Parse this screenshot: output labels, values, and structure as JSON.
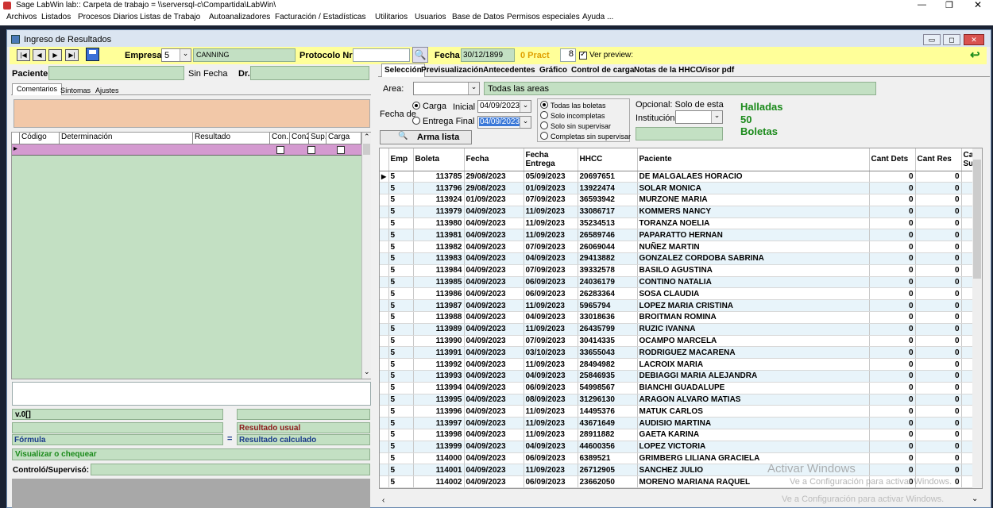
{
  "outer": {
    "title": "Sage LabWin lab:: Carpeta de trabajo = \\\\serversql-c\\Compartida\\LabWin\\"
  },
  "menu": [
    "Archivos",
    "Listados",
    "Procesos Diarios",
    "Listas de Trabajo",
    "Autoanalizadores",
    "Facturación / Estadísticas",
    "Utilitarios",
    "Usuarios",
    "Base de Datos",
    "Permisos especiales",
    "Ayuda ..."
  ],
  "win": {
    "title": "Ingreso de Resultados"
  },
  "toolbar": {
    "empresa_label": "Empresa:",
    "empresa_value": "5",
    "empresa_name": "CANNING",
    "protocolo_label": "Protocolo Nro.:",
    "protocolo_value": "",
    "fecha_label": "Fecha",
    "fecha_value": "30/12/1899",
    "pract": "0 Pract",
    "copies": "8",
    "ver_preview": "Ver preview:"
  },
  "left": {
    "paciente_label": "Paciente:",
    "sin_fecha": "Sin Fecha",
    "dr_label": "Dr.",
    "tabs": [
      "Comentarios",
      "Síntomas",
      "Ajustes"
    ],
    "grid_headers": [
      "Código",
      "Determinación",
      "Resultado",
      "Con.",
      "Con2",
      "Sup.",
      "Carga"
    ],
    "version": "v.0[]",
    "resultado_usual": "Resultado usual",
    "formula": "Fórmula",
    "eq": "=",
    "resultado_calculado": "Resultado calculado",
    "visualizar": "Visualizar o chequear",
    "controlo": "Controló/Supervisó:"
  },
  "right": {
    "tabs": [
      "Selección",
      "Previsualización",
      "Antecedentes",
      "Gráfico",
      "Control de carga",
      "Notas de la HHCC",
      "Visor pdf"
    ],
    "area_label": "Area:",
    "area_value": "Todas las areas",
    "fecha_de": "Fecha de",
    "carga": "Carga",
    "entrega_final": "Entrega Final",
    "inicial": "Inicial",
    "date1": "04/09/2023",
    "date2": "04/09/2023",
    "filters": [
      "Todas las boletas",
      "Solo incompletas",
      "Solo sin supervisar",
      "Completas sin supervisar"
    ],
    "opcional": "Opcional: Solo de esta",
    "institucion": "Institución",
    "halladas": "Halladas",
    "count": "50",
    "boletas": "Boletas",
    "arma_lista": "Arma lista",
    "headers": [
      "Emp",
      "Boleta",
      "Fecha",
      "Fecha Entrega",
      "HHCC",
      "Paciente",
      "Cant Dets",
      "Cant Res",
      "Ca Su"
    ],
    "rows": [
      [
        "5",
        "113785",
        "29/08/2023",
        "05/09/2023",
        "20697651",
        "DE MALGALAES HORACIO",
        "0",
        "0"
      ],
      [
        "5",
        "113796",
        "29/08/2023",
        "01/09/2023",
        "13922474",
        "SOLAR MONICA",
        "0",
        "0"
      ],
      [
        "5",
        "113924",
        "01/09/2023",
        "07/09/2023",
        "36593942",
        "MURZONE MARIA",
        "0",
        "0"
      ],
      [
        "5",
        "113979",
        "04/09/2023",
        "11/09/2023",
        "33086717",
        "KOMMERS NANCY",
        "0",
        "0"
      ],
      [
        "5",
        "113980",
        "04/09/2023",
        "11/09/2023",
        "35234513",
        "TORANZA NOELIA",
        "0",
        "0"
      ],
      [
        "5",
        "113981",
        "04/09/2023",
        "11/09/2023",
        "26589746",
        "PAPARATTO HERNAN",
        "0",
        "0"
      ],
      [
        "5",
        "113982",
        "04/09/2023",
        "07/09/2023",
        "26069044",
        "NUÑEZ MARTIN",
        "0",
        "0"
      ],
      [
        "5",
        "113983",
        "04/09/2023",
        "04/09/2023",
        "29413882",
        "GONZALEZ CORDOBA SABRINA",
        "0",
        "0"
      ],
      [
        "5",
        "113984",
        "04/09/2023",
        "07/09/2023",
        "39332578",
        "BASILO AGUSTINA",
        "0",
        "0"
      ],
      [
        "5",
        "113985",
        "04/09/2023",
        "06/09/2023",
        "24036179",
        "CONTINO NATALIA",
        "0",
        "0"
      ],
      [
        "5",
        "113986",
        "04/09/2023",
        "06/09/2023",
        "26283364",
        "SOSA CLAUDIA",
        "0",
        "0"
      ],
      [
        "5",
        "113987",
        "04/09/2023",
        "11/09/2023",
        "5965794",
        "LOPEZ MARIA CRISTINA",
        "0",
        "0"
      ],
      [
        "5",
        "113988",
        "04/09/2023",
        "04/09/2023",
        "33018636",
        "BROITMAN ROMINA",
        "0",
        "0"
      ],
      [
        "5",
        "113989",
        "04/09/2023",
        "11/09/2023",
        "26435799",
        "RUZIC IVANNA",
        "0",
        "0"
      ],
      [
        "5",
        "113990",
        "04/09/2023",
        "07/09/2023",
        "30414335",
        "OCAMPO MARCELA",
        "0",
        "0"
      ],
      [
        "5",
        "113991",
        "04/09/2023",
        "03/10/2023",
        "33655043",
        "RODRIGUEZ MACARENA",
        "0",
        "0"
      ],
      [
        "5",
        "113992",
        "04/09/2023",
        "11/09/2023",
        "28494982",
        "LACROIX MARIA",
        "0",
        "0"
      ],
      [
        "5",
        "113993",
        "04/09/2023",
        "04/09/2023",
        "25846935",
        "DEBIAGGI MARIA ALEJANDRA",
        "0",
        "0"
      ],
      [
        "5",
        "113994",
        "04/09/2023",
        "06/09/2023",
        "54998567",
        "BIANCHI GUADALUPE",
        "0",
        "0"
      ],
      [
        "5",
        "113995",
        "04/09/2023",
        "08/09/2023",
        "31296130",
        "ARAGON ALVARO MATIAS",
        "0",
        "0"
      ],
      [
        "5",
        "113996",
        "04/09/2023",
        "11/09/2023",
        "14495376",
        "MATUK CARLOS",
        "0",
        "0"
      ],
      [
        "5",
        "113997",
        "04/09/2023",
        "11/09/2023",
        "43671649",
        "AUDISIO MARTINA",
        "0",
        "0"
      ],
      [
        "5",
        "113998",
        "04/09/2023",
        "11/09/2023",
        "28911882",
        "GAETA KARINA",
        "0",
        "0"
      ],
      [
        "5",
        "113999",
        "04/09/2023",
        "04/09/2023",
        "44600356",
        "LOPEZ VICTORIA",
        "0",
        "0"
      ],
      [
        "5",
        "114000",
        "04/09/2023",
        "06/09/2023",
        "6389521",
        "GRIMBERG LILIANA GRACIELA",
        "0",
        "0"
      ],
      [
        "5",
        "114001",
        "04/09/2023",
        "11/09/2023",
        "26712905",
        "SANCHEZ JULIO",
        "0",
        "0"
      ],
      [
        "5",
        "114002",
        "04/09/2023",
        "06/09/2023",
        "23662050",
        "MORENO MARIANA RAQUEL",
        "0",
        "0"
      ]
    ]
  },
  "watermark": {
    "line1": "Activar Windows",
    "line2": "Ve a Configuración para activar Windows.",
    "line3": "Ve a Configuración para activar Windows."
  },
  "colors": {
    "toolbar_yellow": "#ffff99",
    "field_green": "#c3e0c3",
    "comment_peach": "#f2c8a8",
    "grid_pink": "#d49ad0",
    "green_text": "#1a8a1a"
  }
}
